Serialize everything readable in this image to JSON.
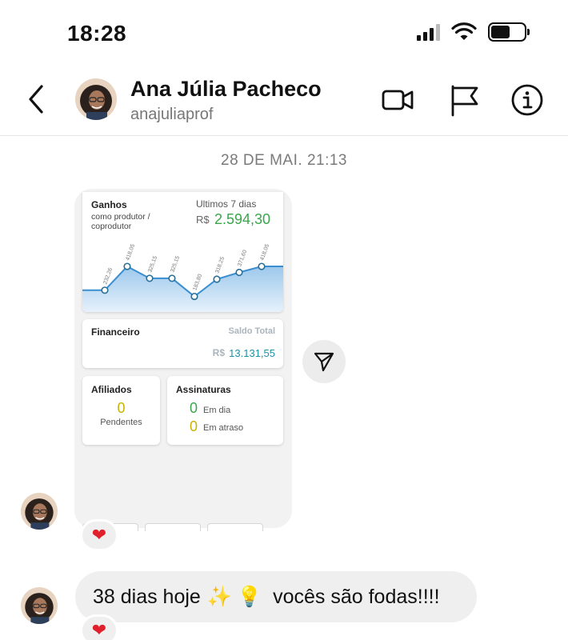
{
  "status_bar": {
    "time": "18:28"
  },
  "header": {
    "contact_name": "Ana Júlia Pacheco",
    "contact_username": "anajuliaprof"
  },
  "conversation": {
    "timestamp": "28 DE MAI. 21:13",
    "shared_screenshot": {
      "ganhos": {
        "title": "Ganhos",
        "subtitle_line1": "como produtor /",
        "subtitle_line2": "coprodutor",
        "period": "Ultimos 7 dias",
        "currency": "R$",
        "amount": "2.594,30"
      },
      "chart_data": {
        "type": "area",
        "categories": [
          "1",
          "2",
          "3",
          "4",
          "5",
          "6",
          "7",
          "8"
        ],
        "values": [
          232.26,
          418.05,
          325.15,
          325.15,
          183.8,
          318.25,
          371.6,
          418.05
        ],
        "point_labels": [
          "232,26",
          "418,05",
          "325,15",
          "325,15",
          "183,80",
          "318,25",
          "371,60",
          "418,05"
        ],
        "title": "",
        "xlabel": "",
        "ylabel": "",
        "ylim": [
          0,
          600
        ],
        "grid": false,
        "colors": {
          "line": "#3b8ed0",
          "fill_top": "#9cc8ec",
          "fill_bottom": "#e6f1fb"
        }
      },
      "financeiro": {
        "title": "Financeiro",
        "label": "Saldo Total",
        "currency": "R$",
        "amount": "13.131,55"
      },
      "afiliados": {
        "title": "Afiliados",
        "count": "0",
        "label": "Pendentes"
      },
      "assinaturas": {
        "title": "Assinaturas",
        "em_dia_count": "0",
        "em_dia_label": "Em dia",
        "em_atraso_count": "0",
        "em_atraso_label": "Em atraso"
      }
    },
    "reaction_1": "❤",
    "message": {
      "text_prefix": "38 dias hoje",
      "emoji_1": "✨",
      "emoji_2": "💡",
      "text_suffix": "vocês são fodas!!!!"
    },
    "reaction_2": "❤"
  },
  "colors": {
    "accent_green": "#3aa64b",
    "accent_teal": "#1f8fa6",
    "accent_yellow": "#c9b300",
    "heart": "#e0202a"
  }
}
